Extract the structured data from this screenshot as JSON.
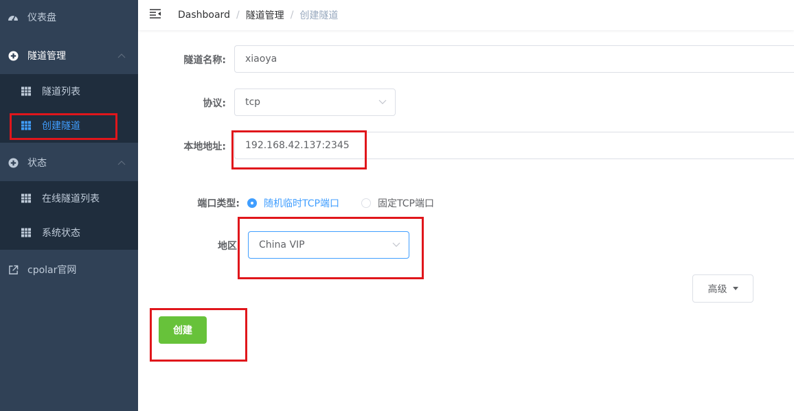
{
  "sidebar": {
    "dashboard": {
      "label": "仪表盘",
      "icon": "speedometer-icon"
    },
    "tunnel_mgmt": {
      "label": "隧道管理",
      "icon": "circle-plus-icon",
      "items": [
        {
          "label": "隧道列表",
          "icon": "table-icon"
        },
        {
          "label": "创建隧道",
          "icon": "table-icon",
          "active": true
        }
      ]
    },
    "status": {
      "label": "状态",
      "icon": "circle-plus-icon",
      "items": [
        {
          "label": "在线隧道列表",
          "icon": "table-icon"
        },
        {
          "label": "系统状态",
          "icon": "table-icon"
        }
      ]
    },
    "cpolar_site": {
      "label": "cpolar官网",
      "icon": "external-link-icon"
    }
  },
  "breadcrumb": {
    "items": [
      "Dashboard",
      "隧道管理",
      "创建隧道"
    ],
    "separator": "/"
  },
  "form": {
    "tunnel_name": {
      "label": "隧道名称:",
      "value": "xiaoya"
    },
    "protocol": {
      "label": "协议:",
      "value": "tcp"
    },
    "local_address": {
      "label": "本地地址:",
      "value": "192.168.42.137:2345"
    },
    "port_type": {
      "label": "端口类型:",
      "options": [
        "随机临时TCP端口",
        "固定TCP端口"
      ],
      "selected": "随机临时TCP端口"
    },
    "region": {
      "label": "地区",
      "value": "China VIP"
    },
    "advanced_label": "高级",
    "create_label": "创建"
  },
  "colors": {
    "sidebar_bg": "#304156",
    "submenu_bg": "#1f2d3d",
    "accent": "#409eff",
    "success": "#67c23a",
    "annotation": "#e0161b"
  }
}
